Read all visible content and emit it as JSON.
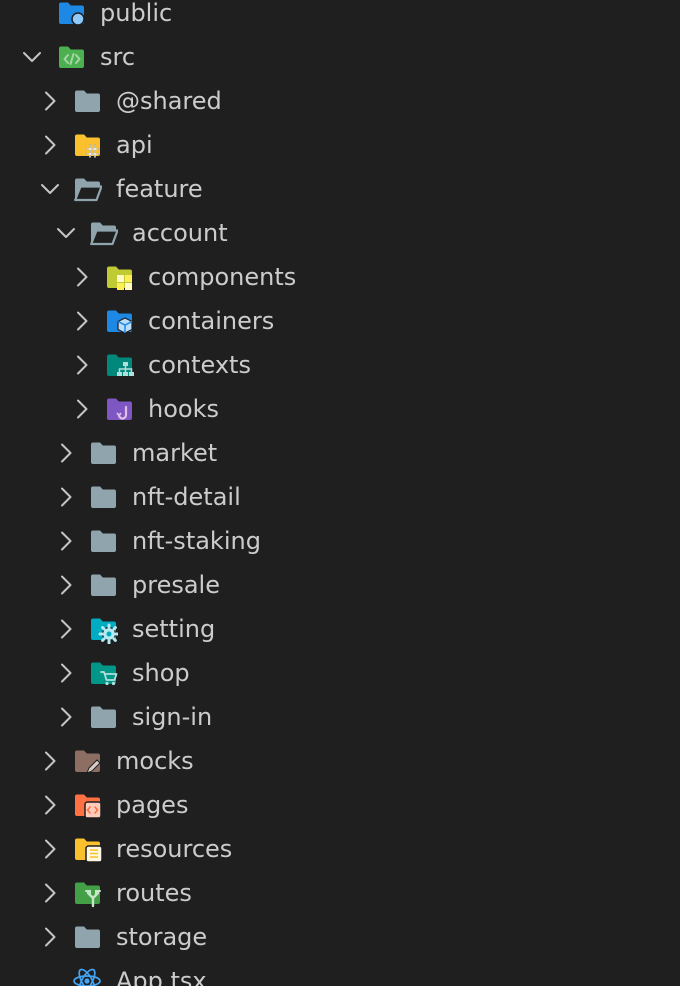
{
  "explorer": {
    "items": [
      {
        "label": "public",
        "depth": 0,
        "expanded": false,
        "chevron": "none",
        "icon": "folder-public-icon"
      },
      {
        "label": "src",
        "depth": 0,
        "expanded": true,
        "chevron": "chevron-down",
        "icon": "folder-src-icon"
      },
      {
        "label": "@shared",
        "depth": 1,
        "expanded": false,
        "chevron": "chevron-right",
        "icon": "folder-icon"
      },
      {
        "label": "api",
        "depth": 1,
        "expanded": false,
        "chevron": "chevron-right",
        "icon": "folder-api-icon"
      },
      {
        "label": "feature",
        "depth": 1,
        "expanded": true,
        "chevron": "chevron-down",
        "icon": "folder-open-icon"
      },
      {
        "label": "account",
        "depth": 2,
        "expanded": true,
        "chevron": "chevron-down",
        "icon": "folder-open-icon"
      },
      {
        "label": "components",
        "depth": 3,
        "expanded": false,
        "chevron": "chevron-right",
        "icon": "folder-components-icon"
      },
      {
        "label": "containers",
        "depth": 3,
        "expanded": false,
        "chevron": "chevron-right",
        "icon": "folder-containers-icon"
      },
      {
        "label": "contexts",
        "depth": 3,
        "expanded": false,
        "chevron": "chevron-right",
        "icon": "folder-contexts-icon"
      },
      {
        "label": "hooks",
        "depth": 3,
        "expanded": false,
        "chevron": "chevron-right",
        "icon": "folder-hooks-icon"
      },
      {
        "label": "market",
        "depth": 2,
        "expanded": false,
        "chevron": "chevron-right",
        "icon": "folder-icon"
      },
      {
        "label": "nft-detail",
        "depth": 2,
        "expanded": false,
        "chevron": "chevron-right",
        "icon": "folder-icon"
      },
      {
        "label": "nft-staking",
        "depth": 2,
        "expanded": false,
        "chevron": "chevron-right",
        "icon": "folder-icon"
      },
      {
        "label": "presale",
        "depth": 2,
        "expanded": false,
        "chevron": "chevron-right",
        "icon": "folder-icon"
      },
      {
        "label": "setting",
        "depth": 2,
        "expanded": false,
        "chevron": "chevron-right",
        "icon": "folder-setting-icon"
      },
      {
        "label": "shop",
        "depth": 2,
        "expanded": false,
        "chevron": "chevron-right",
        "icon": "folder-shop-icon"
      },
      {
        "label": "sign-in",
        "depth": 2,
        "expanded": false,
        "chevron": "chevron-right",
        "icon": "folder-icon"
      },
      {
        "label": "mocks",
        "depth": 1,
        "expanded": false,
        "chevron": "chevron-right",
        "icon": "folder-mocks-icon"
      },
      {
        "label": "pages",
        "depth": 1,
        "expanded": false,
        "chevron": "chevron-right",
        "icon": "folder-pages-icon"
      },
      {
        "label": "resources",
        "depth": 1,
        "expanded": false,
        "chevron": "chevron-right",
        "icon": "folder-resources-icon"
      },
      {
        "label": "routes",
        "depth": 1,
        "expanded": false,
        "chevron": "chevron-right",
        "icon": "folder-routes-icon"
      },
      {
        "label": "storage",
        "depth": 1,
        "expanded": false,
        "chevron": "chevron-right",
        "icon": "folder-icon"
      },
      {
        "label": "App.tsx",
        "depth": 1,
        "expanded": false,
        "chevron": "none",
        "icon": "react-file-icon"
      }
    ]
  },
  "colors": {
    "background": "#1f1f1f",
    "text": "#cccccc",
    "chevron": "#c5c5c5",
    "folder_default": "#90a4ae",
    "folder_src": "#4caf50",
    "folder_api": "#fbc02d",
    "folder_components": "#c0ca33",
    "folder_containers": "#1e88e5",
    "folder_contexts": "#00897b",
    "folder_hooks": "#7e57c2",
    "folder_setting": "#00acc1",
    "folder_shop": "#009688",
    "folder_mocks": "#8d6e63",
    "folder_pages": "#ff7043",
    "folder_resources": "#fbc02d",
    "folder_routes": "#43a047",
    "react": "#42a5f5"
  }
}
